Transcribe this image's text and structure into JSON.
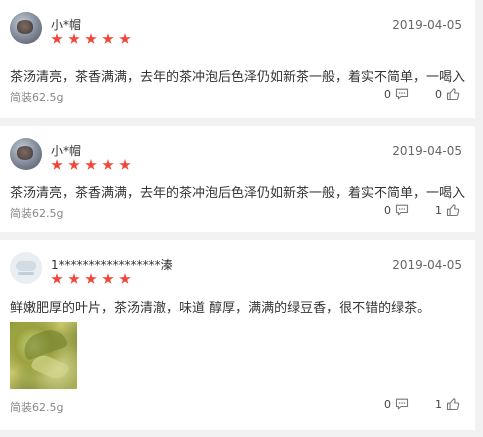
{
  "reviews": [
    {
      "name": "小*帽",
      "rating": 5,
      "date": "2019-04-05",
      "content": "茶汤清亮，茶香满满，去年的茶冲泡后色泽仍如新茶一般，着实不简单，一喝入坑",
      "spec": "简装62.5g",
      "comment_count": "0",
      "like_count": "0",
      "avatar": "tree-avatar"
    },
    {
      "name": "小*帽",
      "rating": 5,
      "date": "2019-04-05",
      "content": "茶汤清亮，茶香满满，去年的茶冲泡后色泽仍如新茶一般，着实不简单，一喝入坑",
      "spec": "简装62.5g",
      "comment_count": "0",
      "like_count": "1",
      "avatar": "tree-avatar"
    },
    {
      "name": "1*****************溱",
      "rating": 5,
      "date": "2019-04-05",
      "content": "鲜嫩肥厚的叶片，茶汤清澈，味道 醇厚，满满的绿豆香，很不错的绿茶。",
      "spec": "简装62.5g",
      "comment_count": "0",
      "like_count": "1",
      "avatar": "light-avatar",
      "photo": "tea-leaves-photo"
    }
  ],
  "colors": {
    "star": "#f0473b",
    "background": "#f2f2f2"
  }
}
